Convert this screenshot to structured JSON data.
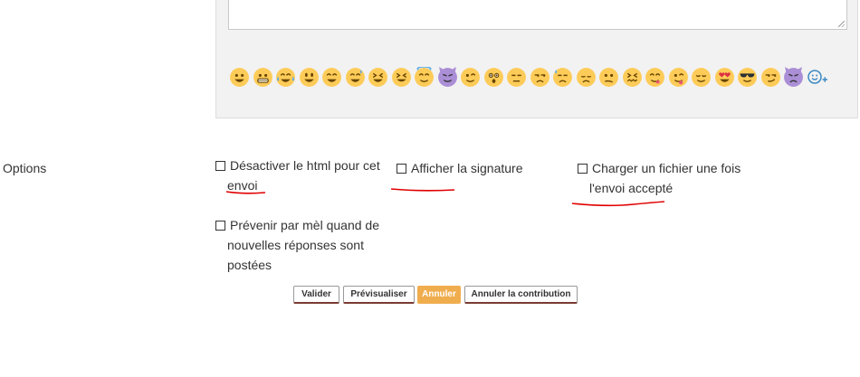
{
  "editor": {
    "emojis": [
      "grinning",
      "grimacing",
      "joy",
      "smiley",
      "smile",
      "sweat-smile",
      "laughing",
      "squint",
      "innocent",
      "smiling-imp",
      "wink",
      "hushed",
      "expressionless",
      "unamused",
      "downcast-sweat",
      "pensive",
      "confused",
      "confounded",
      "savoring",
      "tongue-out",
      "relieved",
      "heart-eyes",
      "sunglasses",
      "smirk",
      "imp",
      "add-emoji"
    ]
  },
  "options": {
    "label": "Options",
    "items": [
      {
        "line1": "Désactiver le html pour cet",
        "line2": "envoi",
        "line3": ""
      },
      {
        "line1": "Afficher la signature",
        "line2": "",
        "line3": ""
      },
      {
        "line1": "Charger un fichier une fois",
        "line2": "l'envoi accepté",
        "line3": ""
      },
      {
        "line1": "Prévenir par mèl quand de",
        "line2": "nouvelles réponses sont",
        "line3": "postées"
      }
    ]
  },
  "buttons": {
    "validate": "Valider",
    "preview": "Prévisualiser",
    "cancel": "Annuler",
    "cancel_contribution": "Annuler la contribution"
  },
  "colors": {
    "primary_button": "#f0ad4e",
    "annotation_underline": "#e00000",
    "emoji_yellow": "#fdcb58",
    "emoji_purple": "#aa8ed6"
  }
}
